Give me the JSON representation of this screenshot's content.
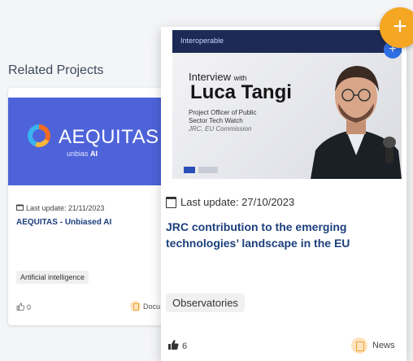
{
  "section": {
    "title": "Related Projects"
  },
  "left_card": {
    "logo_text": "AEQUITAS",
    "logo_sub_prefix": "unbias",
    "logo_sub_bold": "AI",
    "last_update": "Last update: 21/11/2023",
    "title": "AEQUITAS - Unbiased AI",
    "tag": "Artificial intelligence",
    "likes": "0",
    "type": "Docu"
  },
  "right_card": {
    "image": {
      "brand": "Interoperable",
      "interview_prefix": "Interview",
      "interview_suffix": "with",
      "name": "Luca Tangi",
      "role_line1": "Project Officer of Public",
      "role_line2": "Sector Tech Watch",
      "role_line3": "JRC, EU Commission"
    },
    "last_update": "Last update: 27/10/2023",
    "title": "JRC contribution to the emerging technologies’ landscape in the EU",
    "tag": "Observatories",
    "likes": "6",
    "type": "News"
  },
  "buttons": {
    "fab": "+",
    "add_small": "+"
  },
  "colors": {
    "accent_orange": "#f5a623",
    "link_blue": "#1c3f7c",
    "banner_blue": "#4e63d9"
  }
}
